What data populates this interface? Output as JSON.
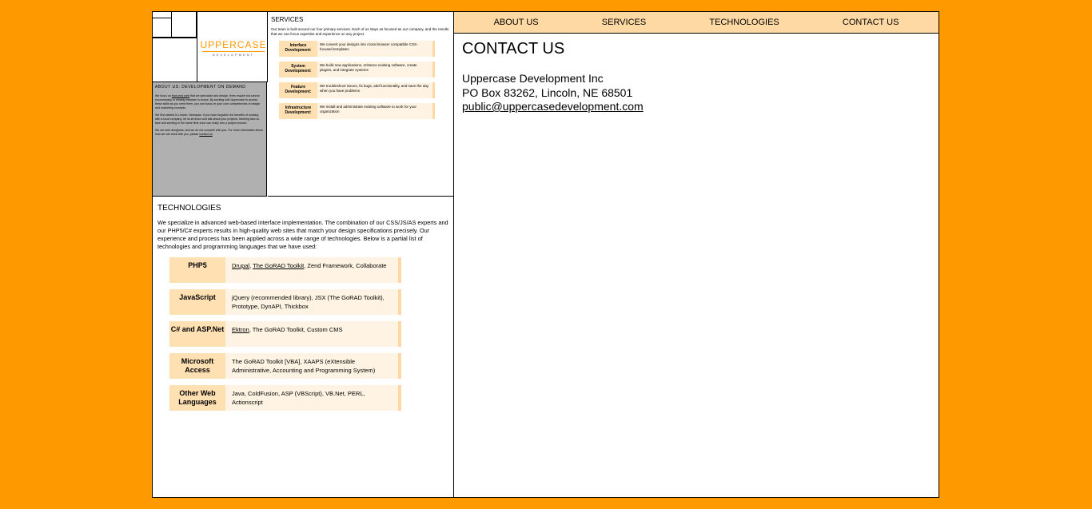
{
  "logo": {
    "main": "UPPERCASE",
    "sub": "DEVELOPMENT"
  },
  "about": {
    "heading": "ABOUT US: DEVELOPMENT ON DEMAND",
    "p1_pre": "We focus on",
    "p1_link": "front-end web",
    "p1_post": " that we specialize and design. firms require but cannot economically or reliably maintain in-house. By working with Uppercase to access these skills as you need them, you can focus on your core competencies of design and marketing concepts.",
    "p2": "We first started in Lincoln, Nebraska. If you have forgotten the benefits of working with a local company, let us sit down and talk about your projects. Meeting face-to-face and working in the same time zone can really turn a project around.",
    "p3_pre": "We are web designers, and we do not compete with you. For more information about how we can work with you, please ",
    "p3_link": "contact us"
  },
  "services": {
    "heading": "SERVICES",
    "intro": "Our team is built around our four primary services. Each of us stays as focused as our company, and the results that we can focus expertise and experience on any project.",
    "items": [
      {
        "key": "Interface Development:",
        "value": "We convert your designs into cross-browser compatible CSS-focused templates"
      },
      {
        "key": "System Development:",
        "value": "We build new applications, enhance existing software, create plugins, and integrate systems"
      },
      {
        "key": "Feature Development:",
        "value": "We troubleshoot issues, fix bugs, add functionality, and save the day when you have problems"
      },
      {
        "key": "Infrastructure Development:",
        "value": "We install and administrate existing software to work for your organization"
      }
    ]
  },
  "technologies": {
    "heading": "TECHNOLOGIES",
    "intro": "We specialize in advanced web-based interface implementation. The combination of our CSS/JS/AS experts and our PHP5/C# experts results in high-quality web sites that match your design specifications precisely. Our experience and process has been applied across a wide range of technologies. Below is a partial list of technologies and programming languages that we have used:",
    "items": [
      {
        "key": "PHP5",
        "link1": "Drupal",
        "sep": ", ",
        "link2": "The GoRAD Toolkit",
        "rest": ", Zend Framework, Collaborate"
      },
      {
        "key": "JavaScript",
        "rest": "jQuery (recommended library), JSX (The GoRAD Toolkit), Prototype, DynAPI, Thickbox"
      },
      {
        "key": "C# and ASP.Net",
        "link1": "Ektron",
        "rest": ", The GoRAD Toolkit, Custom CMS"
      },
      {
        "key": "Microsoft Access",
        "rest": "The GoRAD Toolkit [VBA], XAAPS (eXtensible Administrative, Accounting and Programming System)"
      },
      {
        "key": "Other Web Languages",
        "rest": "Java, ColdFusion, ASP (VBScript), VB.Net, PERL, Actionscript"
      }
    ]
  },
  "nav": {
    "about": "ABOUT US",
    "services": "SERVICES",
    "technologies": "TECHNOLOGIES",
    "contact": "CONTACT US"
  },
  "contact": {
    "heading": "CONTACT US",
    "company": "Uppercase Development Inc",
    "address": "PO Box 83262, Lincoln, NE 68501",
    "email": "public@uppercasedevelopment.com"
  }
}
